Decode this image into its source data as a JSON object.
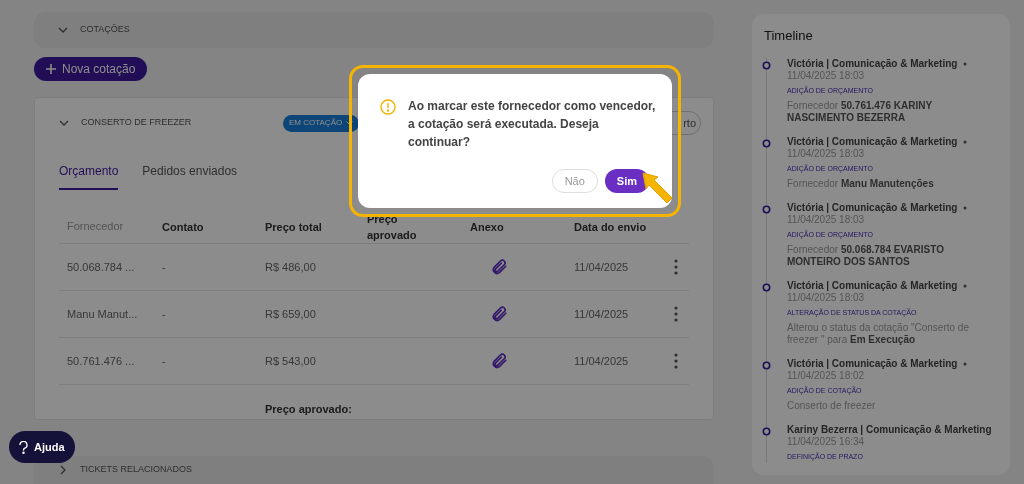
{
  "cotacoes_section": {
    "title": "COTAÇÕES",
    "expanded": true
  },
  "new_button": {
    "label": "Nova cotação"
  },
  "quote_card": {
    "title": "CONSERTO DE FREEZER",
    "expanded": true,
    "status": "EM COTAÇÃO",
    "action_button": "rto",
    "tabs": [
      {
        "label": "Orçamento",
        "selected": true
      },
      {
        "label": "Pedidos enviados",
        "selected": false
      }
    ],
    "table": {
      "columns": [
        "Fornecedor",
        "Contato",
        "Preço total",
        "Preço aprovado",
        "Anexo",
        "Data do envio"
      ],
      "rows": [
        {
          "fornecedor": "50.068.784 ...",
          "contato": "-",
          "preco_total": "R$ 486,00",
          "data": "11/04/2025"
        },
        {
          "fornecedor": "Manu Manut...",
          "contato": "-",
          "preco_total": "R$ 659,00",
          "data": "11/04/2025"
        },
        {
          "fornecedor": "50.761.476 ...",
          "contato": "-",
          "preco_total": "R$ 543,00",
          "data": "11/04/2025"
        }
      ],
      "footer_label": "Preço aprovado:"
    }
  },
  "help_button": {
    "label": "Ajuda"
  },
  "tickets_section": {
    "title": "TICKETS RELACIONADOS",
    "expanded": false
  },
  "timeline": {
    "title": "Timeline",
    "entries": [
      {
        "author": "Victória | Comunicação & Marketing",
        "time": "11/04/2025 18:03",
        "type": "ADIÇÃO DE ORÇAMENTO",
        "detail": "Fornecedor  **50.761.476 KARINY NASCIMENTO BEZERRA**"
      },
      {
        "author": "Victória | Comunicação & Marketing",
        "time": "11/04/2025 18:03",
        "type": "ADIÇÃO DE ORÇAMENTO",
        "detail": "Fornecedor  **Manu Manutenções**"
      },
      {
        "author": "Victória | Comunicação & Marketing",
        "time": "11/04/2025 18:03",
        "type": "ADIÇÃO DE ORÇAMENTO",
        "detail": "Fornecedor  **50.068.784 EVARISTO MONTEIRO DOS SANTOS**"
      },
      {
        "author": "Victória | Comunicação & Marketing",
        "time": "11/04/2025 18:03",
        "type": "ALTERAÇÃO DE STATUS DA COTAÇÃO",
        "detail": "Alterou o status da cotação \"Conserto de freezer \" para **Em Execução**"
      },
      {
        "author": "Victória | Comunicação & Marketing",
        "time": "11/04/2025 18:02",
        "type": "ADIÇÃO DE COTAÇÃO",
        "detail": "Conserto de freezer"
      },
      {
        "author": "Kariny Bezerra | Comunicação & Marketing",
        "time": "11/04/2025 16:34",
        "type": "DEFINIÇÃO DE PRAZO"
      }
    ]
  },
  "dialog": {
    "message": "Ao marcar este fornecedor como vencedor, a cotação será executada. Deseja continuar?",
    "buttons": [
      {
        "label": "Não",
        "kind": "secondary"
      },
      {
        "label": "Sim",
        "kind": "primary"
      }
    ]
  }
}
